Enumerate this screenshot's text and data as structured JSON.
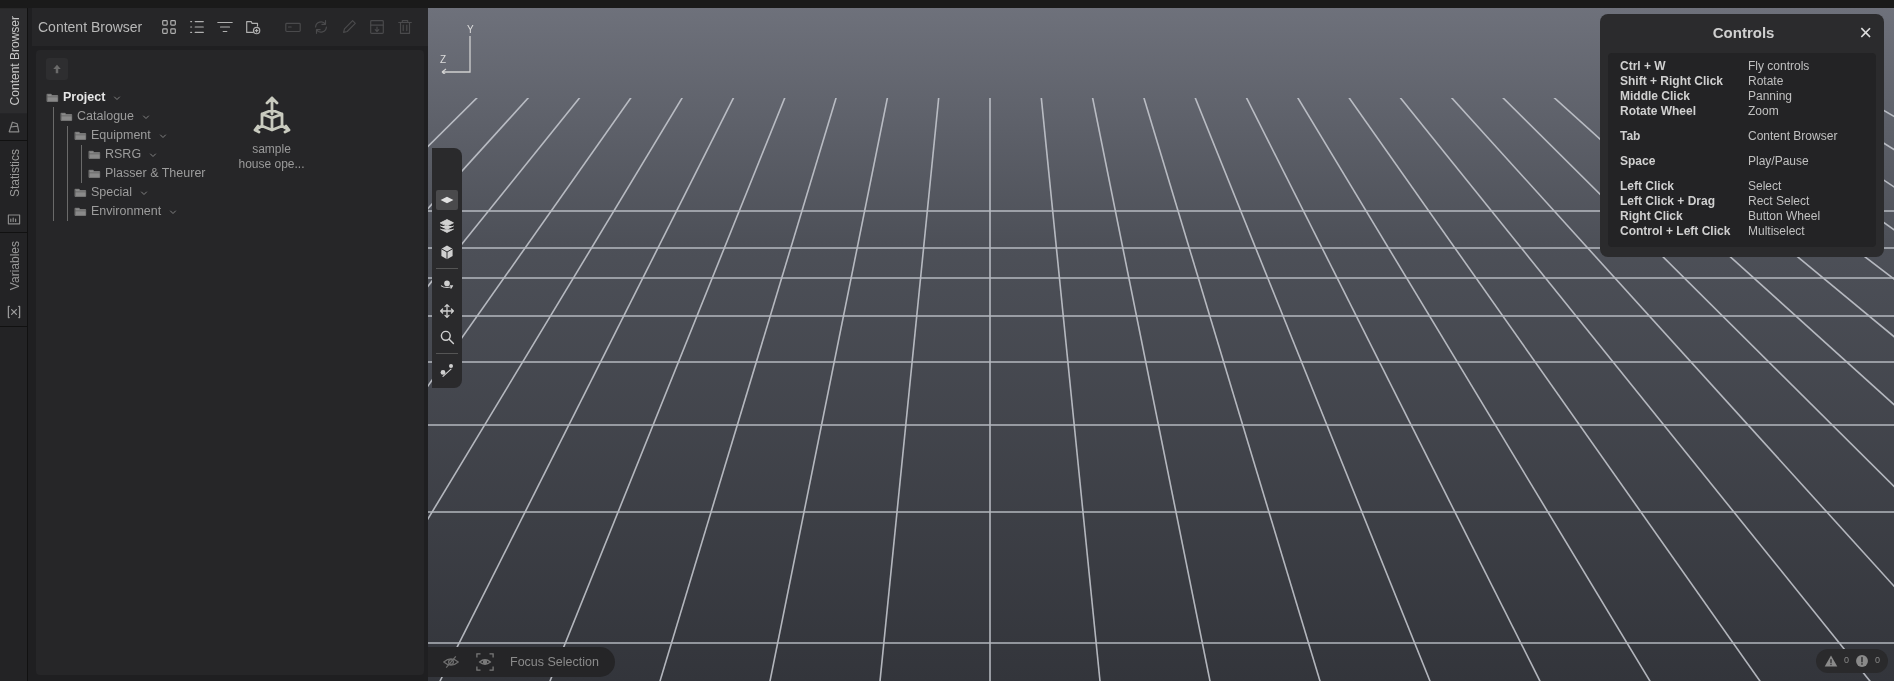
{
  "side_tabs": [
    {
      "label": "Content Browser",
      "kind": "browser",
      "selected": true
    },
    {
      "label": "Statistics",
      "kind": "stats",
      "selected": false
    },
    {
      "label": "Variables",
      "kind": "variables",
      "selected": false
    }
  ],
  "content_browser": {
    "title": "Content Browser",
    "tools": [
      {
        "kind": "grid",
        "disabled": false
      },
      {
        "kind": "list",
        "disabled": false
      },
      {
        "kind": "filter",
        "disabled": false
      },
      {
        "kind": "folder-add",
        "disabled": false
      },
      {
        "kind": "rename",
        "disabled": true
      },
      {
        "kind": "refresh",
        "disabled": true
      },
      {
        "kind": "edit",
        "disabled": true
      },
      {
        "kind": "export",
        "disabled": true
      },
      {
        "kind": "delete",
        "disabled": true
      }
    ],
    "tree": [
      {
        "label": "Project",
        "selected": true,
        "expanded": true,
        "children": [
          {
            "label": "Catalogue",
            "selected": false,
            "expanded": true,
            "children": [
              {
                "label": "Equipment",
                "selected": false,
                "expanded": true,
                "children": [
                  {
                    "label": "RSRG",
                    "selected": false,
                    "expanded": true
                  },
                  {
                    "label": "Plasser & Theurer",
                    "selected": false
                  }
                ]
              },
              {
                "label": "Special",
                "selected": false,
                "expanded": true
              },
              {
                "label": "Environment",
                "selected": false,
                "expanded": true
              }
            ]
          }
        ]
      }
    ],
    "items": [
      {
        "label": "sample house ope..."
      }
    ]
  },
  "viewport": {
    "axis_labels": [
      "Y",
      "Z"
    ],
    "tools": [
      {
        "kind": "plane",
        "selected": true
      },
      {
        "kind": "layers",
        "selected": false
      },
      {
        "kind": "cube",
        "selected": false
      },
      {
        "kind": "divider"
      },
      {
        "kind": "orbit",
        "selected": false
      },
      {
        "kind": "move",
        "selected": false
      },
      {
        "kind": "zoom",
        "selected": false
      },
      {
        "kind": "divider"
      },
      {
        "kind": "path",
        "selected": false
      }
    ],
    "bottom_bar": {
      "focus_label": "Focus Selection"
    },
    "counters": [
      {
        "kind": "warning",
        "count": "0"
      },
      {
        "kind": "info",
        "count": "0"
      }
    ]
  },
  "controls": {
    "title": "Controls",
    "close": "×",
    "groups": [
      [
        {
          "key": "Ctrl + W",
          "action": "Fly controls"
        },
        {
          "key": "Shift + Right Click",
          "action": "Rotate"
        },
        {
          "key": "Middle Click",
          "action": "Panning"
        },
        {
          "key": "Rotate Wheel",
          "action": "Zoom"
        }
      ],
      [
        {
          "key": "Tab",
          "action": "Content Browser"
        }
      ],
      [
        {
          "key": "Space",
          "action": "Play/Pause"
        }
      ],
      [
        {
          "key": "Left Click",
          "action": "Select"
        },
        {
          "key": "Left Click + Drag",
          "action": "Rect Select"
        },
        {
          "key": "Right Click",
          "action": "Button Wheel"
        },
        {
          "key": "Control + Left Click",
          "action": "Multiselect"
        }
      ]
    ]
  }
}
